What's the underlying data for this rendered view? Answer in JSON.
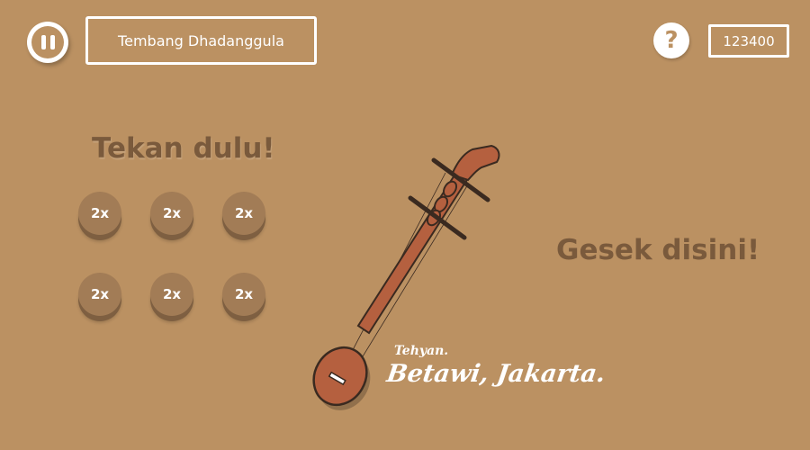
{
  "header": {
    "song_title": "Tembang Dhadanggula",
    "help_symbol": "?",
    "score": "123400"
  },
  "left_panel": {
    "heading": "Tekan dulu!",
    "buttons": [
      {
        "label": "2x"
      },
      {
        "label": "2x"
      },
      {
        "label": "2x"
      },
      {
        "label": "2x"
      },
      {
        "label": "2x"
      },
      {
        "label": "2x"
      }
    ]
  },
  "right_panel": {
    "heading": "Gesek disini!"
  },
  "instrument": {
    "name_small": "Tehyan.",
    "origin": "Betawi, Jakarta.",
    "icon": "tehyan-instrument-icon"
  },
  "colors": {
    "background": "#bb9162",
    "heading_text": "#7a5a3c",
    "button_face": "#a27c56",
    "button_shadow": "#7e5f41",
    "instrument_body": "#b5603f",
    "outline": "#3a2a20"
  }
}
